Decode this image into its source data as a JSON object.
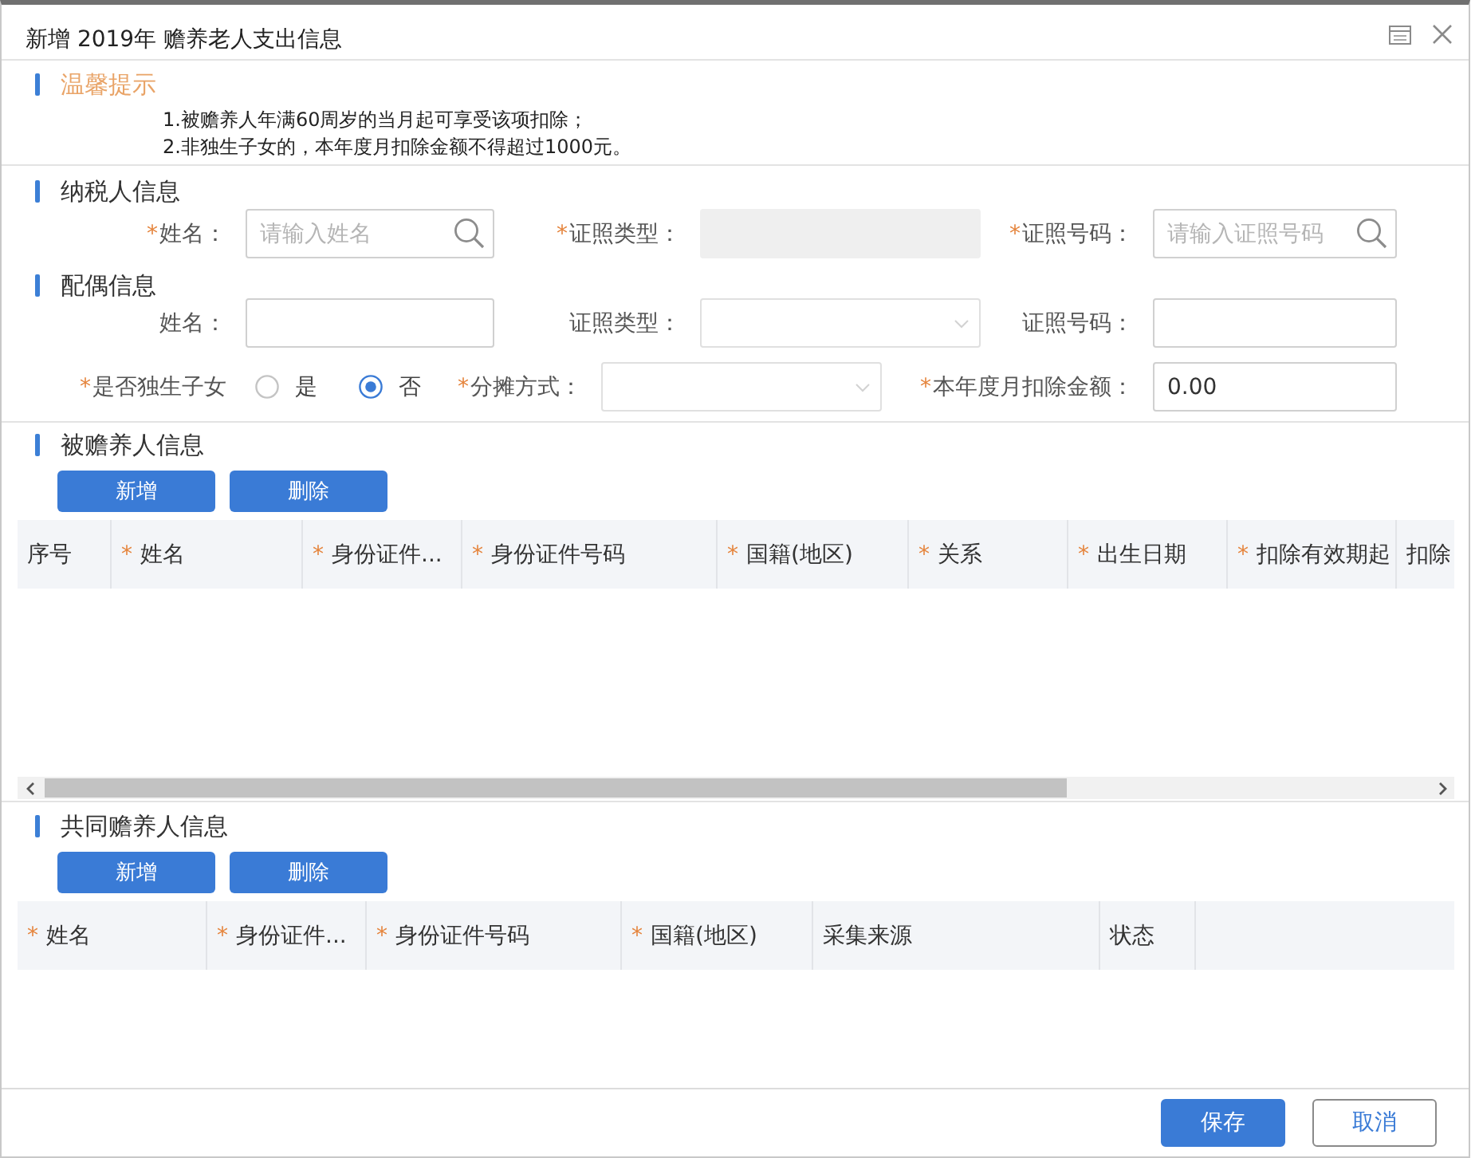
{
  "window": {
    "title": "新增 2019年 赡养老人支出信息"
  },
  "tips": {
    "title": "温馨提示",
    "lines": [
      "1.被赡养人年满60周岁的当月起可享受该项扣除；",
      "2.非独生子女的，本年度月扣除金额不得超过1000元。"
    ]
  },
  "taxpayer": {
    "title": "纳税人信息",
    "rows": [
      [
        {
          "mark": "*",
          "label": "姓名：",
          "kind": "search",
          "placeholder": "请输入姓名",
          "disabled": false
        },
        {
          "mark": "*",
          "label": "证照类型：",
          "kind": "input",
          "disabled": true
        },
        {
          "mark": "*",
          "label": "证照号码：",
          "kind": "search",
          "placeholder": "请输入证照号码",
          "disabled": false
        }
      ]
    ]
  },
  "spouse": {
    "title": "配偶信息",
    "rows": [
      [
        {
          "label": "姓名：",
          "kind": "input",
          "disabled": false
        },
        {
          "label": "证照类型：",
          "kind": "select",
          "disabled": false
        },
        {
          "label": "证照号码：",
          "kind": "input",
          "disabled": false
        }
      ],
      [
        {
          "mark": "*",
          "label": "是否独生子女",
          "kind": "radio",
          "disabled": false,
          "options": [
            {
              "label": "是",
              "selected": false
            },
            {
              "label": "否",
              "selected": true
            }
          ]
        },
        {
          "mark": "*",
          "label": "分摊方式：",
          "kind": "select",
          "disabled": false
        },
        {
          "mark": "*",
          "label": "本年度月扣除金额：",
          "kind": "input",
          "value": "0.00",
          "disabled": false
        }
      ]
    ]
  },
  "dependents": {
    "title": "被赡养人信息",
    "buttons": [
      "新增",
      "删除"
    ],
    "columns": [
      {
        "label": "序号"
      },
      {
        "mark": "*",
        "label": "姓名"
      },
      {
        "mark": "*",
        "label": "身份证件..."
      },
      {
        "mark": "*",
        "label": "身份证件号码"
      },
      {
        "mark": "*",
        "label": "国籍(地区)"
      },
      {
        "mark": "*",
        "label": "关系"
      },
      {
        "mark": "*",
        "label": "出生日期"
      },
      {
        "mark": "*",
        "label": "扣除有效期起"
      },
      {
        "label": "扣除"
      }
    ]
  },
  "co_supporters": {
    "title": "共同赡养人信息",
    "buttons": [
      "新增",
      "删除"
    ],
    "columns": [
      {
        "mark": "*",
        "label": "姓名"
      },
      {
        "mark": "*",
        "label": "身份证件..."
      },
      {
        "mark": "*",
        "label": "身份证件号码"
      },
      {
        "mark": "*",
        "label": "国籍(地区)"
      },
      {
        "label": "采集来源"
      },
      {
        "label": "状态"
      }
    ]
  },
  "footer": {
    "buttons": [
      {
        "label": "保存",
        "kind": "primary"
      },
      {
        "label": "取消",
        "kind": "secondary"
      }
    ]
  }
}
